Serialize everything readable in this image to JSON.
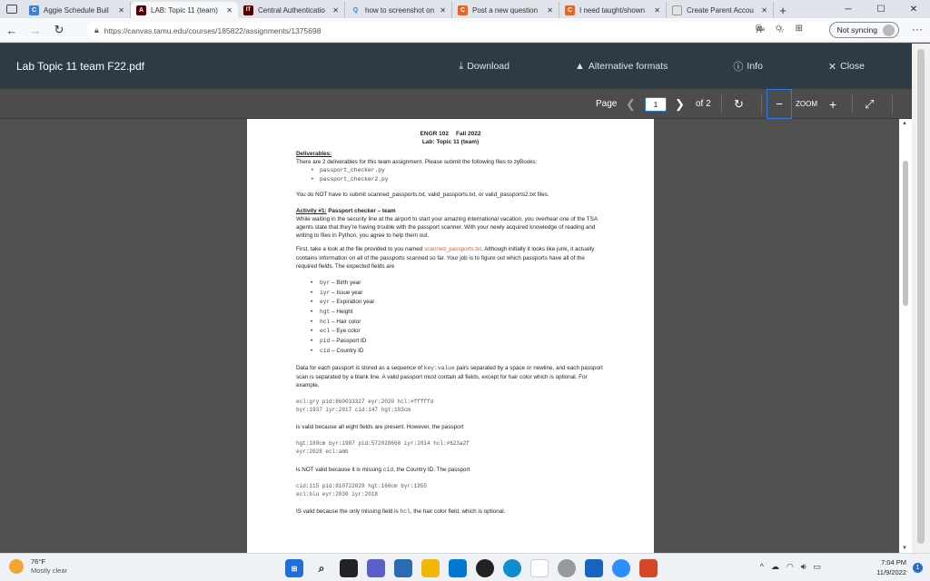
{
  "browser": {
    "tabs": [
      {
        "title": "Aggie Schedule Buil",
        "fav_letter": "C",
        "fav_color": "#3b82d6"
      },
      {
        "title": "LAB: Topic 11 (team)",
        "fav_letter": "A",
        "fav_color": "#500000"
      },
      {
        "title": "Central Authenticatio",
        "fav_letter": "IT",
        "fav_color": "#500000"
      },
      {
        "title": "how to screenshot on",
        "fav_letter": "Q",
        "fav_color": "#ffffff"
      },
      {
        "title": "Post a new question",
        "fav_letter": "C",
        "fav_color": "#e5642a"
      },
      {
        "title": "I need taught/shown",
        "fav_letter": "C",
        "fav_color": "#e5642a"
      },
      {
        "title": "Create Parent Accou",
        "fav_letter": "",
        "fav_color": "#ffffff"
      }
    ],
    "new_tab": "+",
    "url": "https://canvas.tamu.edu/courses/185822/assignments/1375698",
    "sync_label": "Not syncing"
  },
  "viewer": {
    "doc_title": "Lab Topic 11 team F22.pdf",
    "download_label": "Download",
    "alt_formats_label": "Alternative formats",
    "info_label": "Info",
    "close_label": "Close",
    "page_label": "Page",
    "current_page": "1",
    "of_pages": "of 2",
    "zoom_label": "ZOOM"
  },
  "document": {
    "course": "ENGR 102",
    "term": "Fall 2022",
    "lab_title": "Lab: Topic 11 (team)",
    "deliverables_heading": "Deliverables:",
    "deliverables_intro": "There are 2 deliverables for this team assignment. Please submit the following files to zyBooks:",
    "deliverable_files": [
      "passport_checker.py",
      "passport_checker2.py"
    ],
    "no_submit_note": "You do NOT have to submit scanned_passports.txt, valid_passports.txt, or valid_passports2.txt files.",
    "activity_heading": "Activity #1:",
    "activity_title": " Passport checker – team",
    "activity_intro": "While waiting in the security line at the airport to start your amazing international vacation, you overhear one of the TSA agents state that they’re having trouble with the passport scanner. With your newly acquired knowledge of reading and writing to files in Python, you agree to help them out.",
    "first_a": "First, take a look at the file provided to you named ",
    "first_file": "scanned_passports.txt",
    "first_b": ". Although initially it looks like junk, it actually contains information on all of the passports scanned so far. Your job is to figure out which passports have all of the required fields. The expected fields are",
    "fields": [
      {
        "key": "byr",
        "desc": " – Birth year"
      },
      {
        "key": "iyr",
        "desc": " – Issue year"
      },
      {
        "key": "eyr",
        "desc": " – Expiration year"
      },
      {
        "key": "hgt",
        "desc": " – Height"
      },
      {
        "key": "hcl",
        "desc": " – Hair color"
      },
      {
        "key": "ecl",
        "desc": " – Eye color"
      },
      {
        "key": "pid",
        "desc": " – Passport ID"
      },
      {
        "key": "cid",
        "desc": " – Country ID"
      }
    ],
    "data_a": "Data for each passport is stored as a sequence of ",
    "data_kv": "key:value",
    "data_b": " pairs separated by a space or newline, and each passport scan is separated by a blank line. A valid passport must contain all fields, except for hair color which is optional. For example,",
    "example1": [
      "ecl:gry pid:860033327 eyr:2020 hcl:#fffffd",
      "byr:1937 iyr:2017 cid:147 hgt:183cm"
    ],
    "valid1": "is valid because all eight fields are present. However, the passport",
    "example2": [
      "hgt:189cm byr:1987 pid:572028668 iyr:2014 hcl:#623a2f",
      "eyr:2028 ecl:amb"
    ],
    "notvalid_a": "is NOT valid because it is missing ",
    "notvalid_key": "cid",
    "notvalid_b": ", the Country ID. The passport",
    "example3": [
      "cid:115 pid:810722029 hgt:166cm byr:1955",
      "ecl:blu eyr:2030 iyr:2018"
    ],
    "valid3_a": "IS valid because the only missing field is ",
    "valid3_key": "hcl",
    "valid3_b": ", the hair color field, which is optional."
  },
  "taskbar": {
    "temp": "76°F",
    "weather": "Mostly clear",
    "time": "7:04 PM",
    "date": "11/9/2022",
    "notifications": "1"
  }
}
